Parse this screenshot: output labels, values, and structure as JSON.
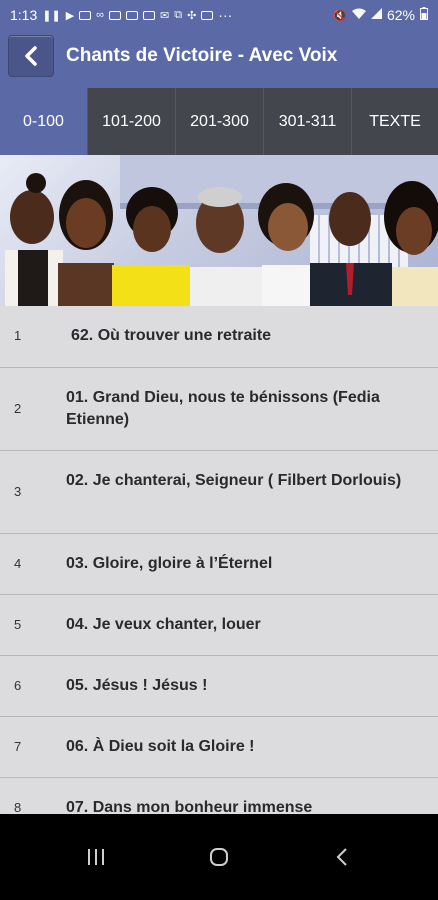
{
  "status_bar": {
    "time": "1:13",
    "battery": "62%",
    "more": "···",
    "left_icons": [
      "pause-icon",
      "youtube-icon",
      "image-icon",
      "infinity-icon",
      "news-icon",
      "message-icon",
      "photo-icon",
      "mail-icon",
      "wallet-icon",
      "pinwheel-icon",
      "news2-icon"
    ],
    "right_icons": [
      "mute-icon",
      "wifi-icon",
      "signal-icon",
      "battery-icon"
    ]
  },
  "app_bar": {
    "title": "Chants de Victoire - Avec Voix",
    "back_icon": "chevron-left-icon"
  },
  "tabs": [
    {
      "label": "0-100",
      "active": true
    },
    {
      "label": "101-200",
      "active": false
    },
    {
      "label": "201-300",
      "active": false
    },
    {
      "label": "301-311",
      "active": false
    },
    {
      "label": "TEXTE",
      "active": false
    }
  ],
  "banner": {
    "description_icon": "singers-banner-image"
  },
  "songs": [
    {
      "num": "1",
      "title": "62. Où trouver une retraite"
    },
    {
      "num": "2",
      "title": "01. Grand Dieu, nous te bénissons (Fedia Etienne)"
    },
    {
      "num": "3",
      "title": "02. Je chanterai, Seigneur ( Filbert Dorlouis)"
    },
    {
      "num": "4",
      "title": "03. Gloire, gloire à l’Éternel"
    },
    {
      "num": "5",
      "title": "04. Je veux chanter, louer"
    },
    {
      "num": "6",
      "title": "05. Jésus ! Jésus !"
    },
    {
      "num": "7",
      "title": "06. À Dieu soit la Gloire !"
    },
    {
      "num": "8",
      "title": "07. Dans mon bonheur immense"
    }
  ],
  "nav_bar": {
    "recents_icon": "recents-icon",
    "home_icon": "home-icon",
    "back_icon": "back-icon"
  },
  "colors": {
    "primary": "#5b6aa6",
    "tab_bg": "#43474d",
    "list_bg": "#dcdcde"
  }
}
